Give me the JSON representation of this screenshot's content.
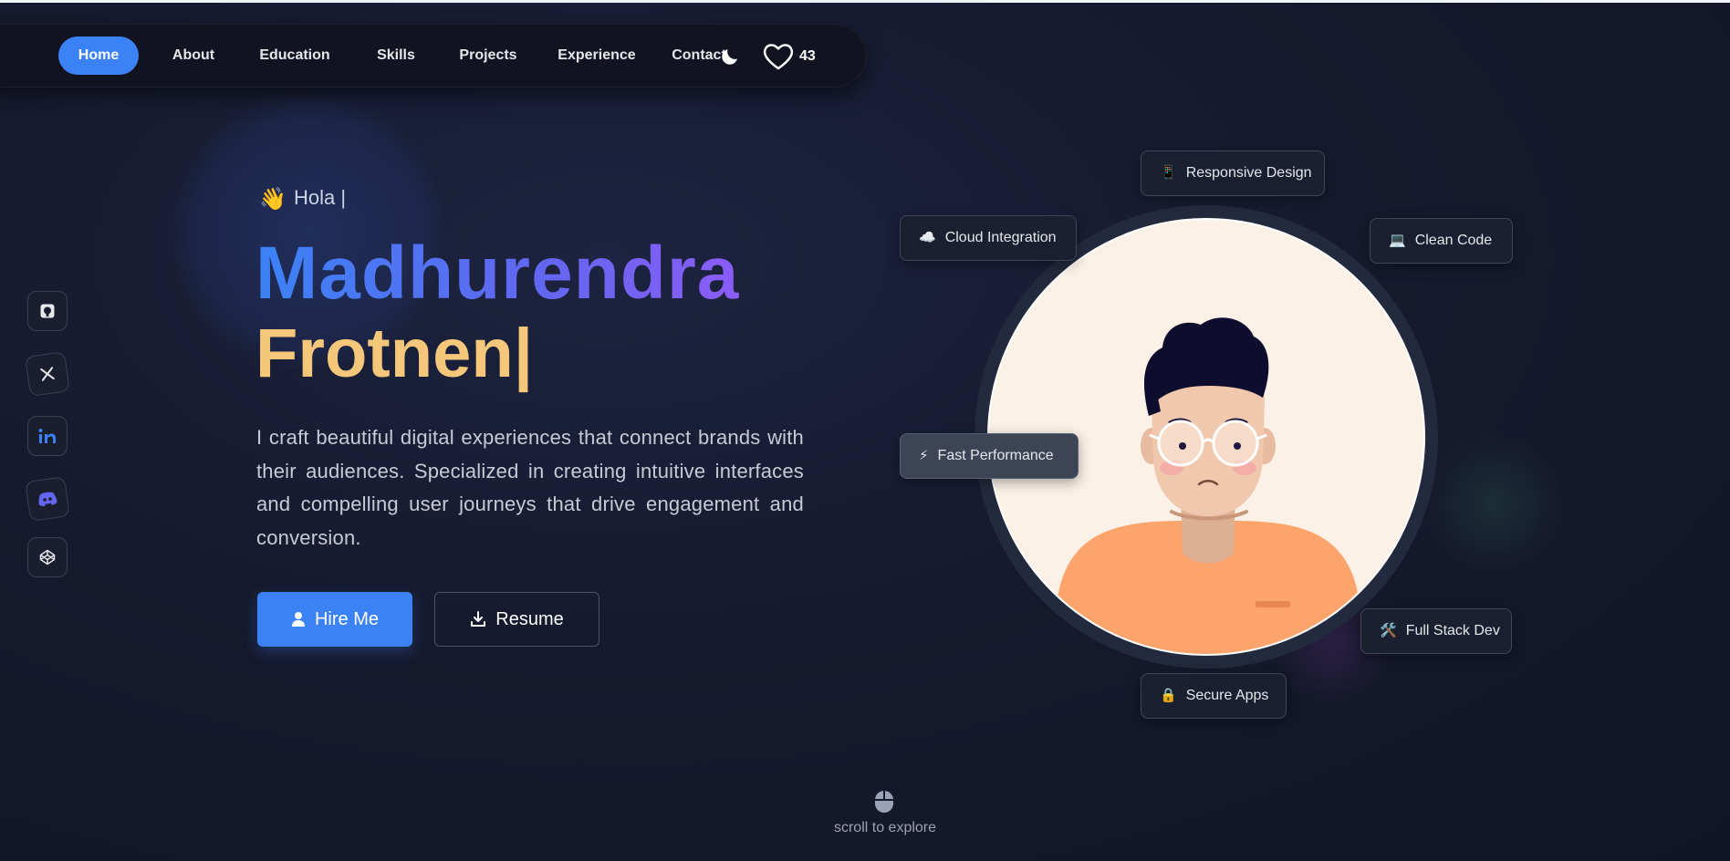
{
  "nav": {
    "items": [
      {
        "label": "Home",
        "active": true
      },
      {
        "label": "About"
      },
      {
        "label": "Education"
      },
      {
        "label": "Skills"
      },
      {
        "label": "Projects"
      },
      {
        "label": "Experience"
      },
      {
        "label": "Contact"
      }
    ],
    "theme_icon": "moon-icon",
    "like_icon": "heart-icon",
    "like_count": "43"
  },
  "social": [
    {
      "name": "github-icon"
    },
    {
      "name": "x-icon"
    },
    {
      "name": "linkedin-icon"
    },
    {
      "name": "discord-icon"
    },
    {
      "name": "codepen-icon"
    }
  ],
  "hero": {
    "greeting_emoji": "👋",
    "greeting": "Hola |",
    "name": "Madhurendra",
    "role_typing": "Frotnen|",
    "description": "I craft beautiful digital experiences that connect brands with their audiences. Specialized in creating intuitive interfaces and compelling user journeys that drive engagement and conversion.",
    "hire_label": "Hire Me",
    "resume_label": "Resume"
  },
  "chips": {
    "responsive": {
      "icon": "📱",
      "label": "Responsive Design"
    },
    "cloud": {
      "icon": "☁️",
      "label": "Cloud Integration"
    },
    "clean": {
      "icon": "💻",
      "label": "Clean Code"
    },
    "fast": {
      "icon": "⚡",
      "label": "Fast Performance"
    },
    "fullstack": {
      "icon": "🛠️",
      "label": "Full Stack Dev"
    },
    "secure": {
      "icon": "🔒",
      "label": "Secure Apps"
    }
  },
  "scroll": {
    "label": "scroll to explore"
  },
  "colors": {
    "accent": "#3b82f6",
    "name_gradient_end": "#8b5cf6",
    "role": "#f4c77b",
    "background": "#161a2e"
  }
}
